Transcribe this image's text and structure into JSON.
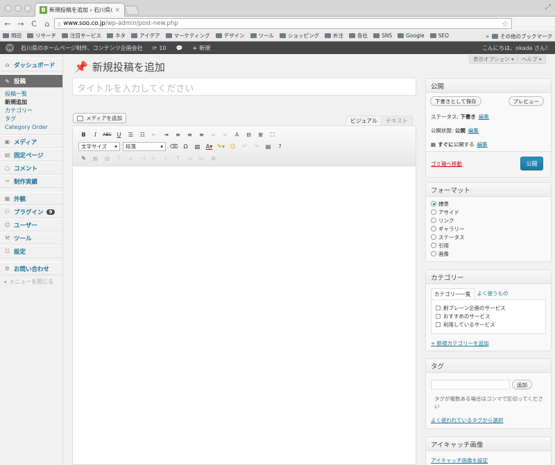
{
  "browser": {
    "tab_title": "新規投稿を追加 ‹ 石川県のホー",
    "favicon_letter": "B",
    "url_host": "www.soo.co.jp",
    "url_path": "/wp-admin/post-new.php",
    "bookmarks": [
      "岡田",
      "リサーチ",
      "注目サービス",
      "ネタ",
      "アイデア",
      "マーケティング",
      "デザイン",
      "ツール",
      "ショッピング",
      "外注",
      "各社",
      "SNS",
      "Google",
      "SEO"
    ],
    "bookmarks_other": "その他のブックマーク"
  },
  "adminbar": {
    "site_name": "石川県のホームページ制作、コンテンツ企画会社",
    "updates_count": "10",
    "new_label": "新規",
    "howdy": "こんにちは、okada さん！"
  },
  "sidebar": {
    "dashboard": "ダッシュボード",
    "posts": "投稿",
    "posts_sub": [
      "投稿一覧",
      "新規追加",
      "カテゴリー",
      "タグ",
      "Category Order"
    ],
    "media": "メディア",
    "pages": "固定ページ",
    "comments": "コメント",
    "works": "制作実績",
    "appearance": "外観",
    "plugins": "プラグイン",
    "plugins_badge": "9",
    "users": "ユーザー",
    "tools": "ツール",
    "settings": "設定",
    "contact": "お問い合わせ",
    "collapse": "メニューを閉じる"
  },
  "header": {
    "screen_options": "表示オプション ▾",
    "help": "ヘルプ ▾",
    "page_title": "新規投稿を追加"
  },
  "editor": {
    "title_placeholder": "タイトルを入力してください",
    "add_media": "メディアを追加",
    "tab_visual": "ビジュアル",
    "tab_text": "テキスト",
    "font_size_select": "文字サイズ",
    "format_select": "段落"
  },
  "publish": {
    "heading": "公開",
    "save_draft": "下書きとして保存",
    "preview": "プレビュー",
    "status_label": "ステータス:",
    "status_value": "下書き",
    "visibility_label": "公開状態:",
    "visibility_value": "公開",
    "schedule_prefix": "すぐに",
    "schedule_label": "公開する",
    "edit": "編集",
    "trash": "ゴミ箱へ移動",
    "publish_btn": "公開"
  },
  "format": {
    "heading": "フォーマット",
    "options": [
      "標準",
      "アサイド",
      "リンク",
      "ギャラリー",
      "ステータス",
      "引用",
      "画像"
    ]
  },
  "categories": {
    "heading": "カテゴリー",
    "tab_all": "カテゴリー一覧",
    "tab_popular": "よく使うもの",
    "items": [
      "創ブレーン企画のサービス",
      "おすすめのサービス",
      "利用しているサービス"
    ],
    "add_new": "+ 新規カテゴリーを追加"
  },
  "tags": {
    "heading": "タグ",
    "add_btn": "追加",
    "hint": "タグが複数ある場合はコンマで区切ってください",
    "popular_link": "よく使われているタグから選択"
  },
  "thumbnail": {
    "heading": "アイキャッチ画像",
    "set_link": "アイキャッチ画像を設定"
  },
  "colors": {
    "link": "#21759b",
    "adminbar": "#464646",
    "trash": "#bc0b0b"
  }
}
